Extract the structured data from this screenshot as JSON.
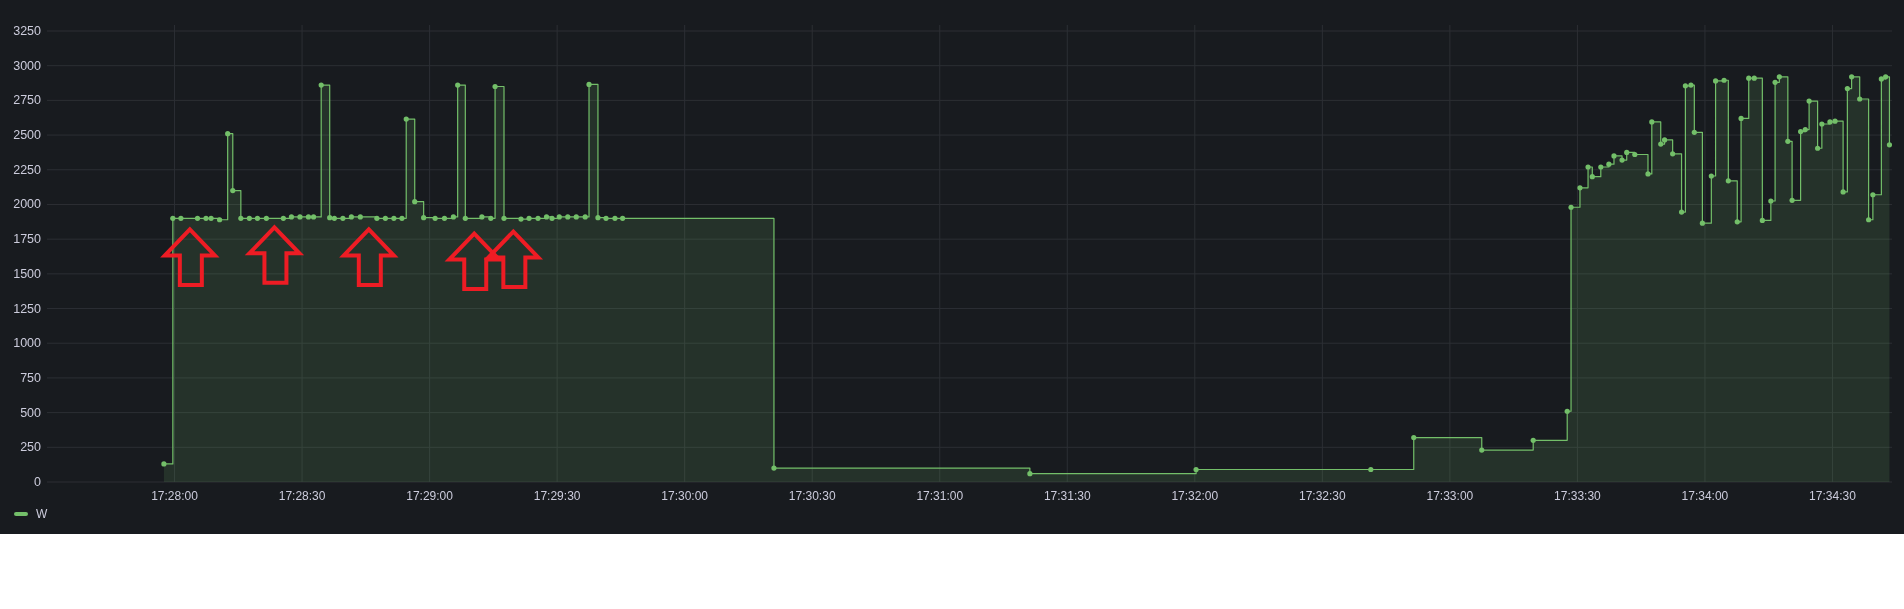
{
  "panel": {
    "chart_data": {
      "type": "area",
      "grid": true,
      "x": [
        62877.5,
        62879.6,
        62879.6,
        62881.5,
        62881.5,
        62885.4,
        62885.4,
        62887.4,
        62887.4,
        62888.6,
        62888.6,
        62890.6,
        62890.6,
        62892.5,
        62892.5,
        62893.7,
        62893.7,
        62895.6,
        62895.6,
        62897.6,
        62897.6,
        62899.5,
        62899.5,
        62901.6,
        62901.6,
        62905.6,
        62905.6,
        62907.5,
        62907.5,
        62909.5,
        62909.5,
        62911.5,
        62911.5,
        62912.7,
        62912.7,
        62914.5,
        62914.5,
        62916.5,
        62916.5,
        62917.6,
        62917.6,
        62919.6,
        62919.6,
        62921.6,
        62921.6,
        62923.7,
        62923.7,
        62927.6,
        62927.6,
        62929.6,
        62929.6,
        62931.6,
        62931.6,
        62933.5,
        62933.5,
        62934.5,
        62934.5,
        62936.5,
        62936.5,
        62938.6,
        62938.6,
        62941.3,
        62941.3,
        62943.5,
        62943.5,
        62945.6,
        62945.6,
        62946.6,
        62946.6,
        62948.4,
        62948.4,
        62952.3,
        62952.3,
        62954.4,
        62954.4,
        62955.4,
        62955.4,
        62957.5,
        62957.5,
        62961.5,
        62961.5,
        62963.4,
        62963.4,
        62965.5,
        62965.5,
        62967.5,
        62967.5,
        62968.8,
        62968.8,
        62970.5,
        62970.5,
        62972.5,
        62972.5,
        62974.5,
        62974.5,
        62976.6,
        62976.6,
        62977.5,
        62977.5,
        62979.6,
        62979.6,
        62981.5,
        62981.5,
        62983.6,
        62983.6,
        62985.4,
        62985.4,
        63021,
        63021,
        63081.2,
        63081.2,
        63120.3,
        63120.3,
        63161.4,
        63161.4,
        63171.5,
        63171.5,
        63187.5,
        63187.5,
        63199.6,
        63199.6,
        63207.6,
        63207.6,
        63208.5,
        63208.5,
        63210.6,
        63210.6,
        63212.5,
        63212.5,
        63213.5,
        63213.5,
        63215.5,
        63215.5,
        63217.4,
        63217.4,
        63218.6,
        63218.6,
        63220.5,
        63220.5,
        63221.6,
        63221.6,
        63223.5,
        63223.5,
        63226.6,
        63226.6,
        63227.5,
        63227.5,
        63229.6,
        63229.6,
        63230.5,
        63230.5,
        63232.4,
        63232.4,
        63234.5,
        63234.5,
        63235.4,
        63235.4,
        63236.7,
        63236.7,
        63237.5,
        63237.5,
        63239.4,
        63239.4,
        63241.5,
        63241.5,
        63242.5,
        63242.5,
        63244.5,
        63244.5,
        63245.5,
        63245.5,
        63247.6,
        63247.6,
        63248.5,
        63248.5,
        63250.3,
        63250.3,
        63251.6,
        63251.6,
        63253.5,
        63253.5,
        63255.5,
        63255.5,
        63256.5,
        63256.5,
        63257.5,
        63257.5,
        63259.5,
        63259.5,
        63260.5,
        63260.5,
        63262.5,
        63262.5,
        63263.6,
        63263.6,
        63264.5,
        63264.5,
        63266.5,
        63266.5,
        63267.5,
        63267.5,
        63269.4,
        63269.4,
        63270.6,
        63270.6,
        63272.5,
        63272.5,
        63273.5,
        63273.5,
        63274.5,
        63274.5,
        63276.4,
        63276.4,
        63278.5,
        63278.5,
        63279.5,
        63279.5,
        63281.5,
        63281.5,
        63282.5,
        63282.5,
        63283.4,
        63283.4
      ],
      "series": [
        {
          "name": "W",
          "color": "#73bf69",
          "values": [
            130,
            130,
            1900,
            1900,
            1900,
            1900,
            1900,
            1900,
            1900,
            1900,
            1900,
            1900,
            1890,
            1890,
            2510,
            2510,
            2100,
            2100,
            1900,
            1900,
            1900,
            1900,
            1900,
            1900,
            1900,
            1900,
            1900,
            1900,
            1910,
            1910,
            1910,
            1910,
            1910,
            1910,
            1910,
            1910,
            2860,
            2860,
            1905,
            1905,
            1900,
            1900,
            1900,
            1900,
            1910,
            1910,
            1910,
            1910,
            1900,
            1900,
            1900,
            1900,
            1900,
            1900,
            1900,
            1900,
            2615,
            2615,
            2020,
            2020,
            1905,
            1905,
            1900,
            1900,
            1900,
            1900,
            1910,
            1910,
            2860,
            2860,
            1900,
            1900,
            1910,
            1910,
            1900,
            1900,
            2850,
            2850,
            1900,
            1900,
            1895,
            1895,
            1900,
            1900,
            1900,
            1900,
            1910,
            1910,
            1900,
            1900,
            1910,
            1910,
            1910,
            1910,
            1910,
            1910,
            1910,
            1910,
            2865,
            2865,
            1905,
            1905,
            1900,
            1900,
            1900,
            1900,
            1900,
            1900,
            100,
            100,
            60,
            60,
            90,
            90,
            90,
            90,
            320,
            320,
            230,
            230,
            300,
            300,
            510,
            510,
            1980,
            1980,
            2120,
            2120,
            2270,
            2270,
            2200,
            2200,
            2270,
            2270,
            2290,
            2290,
            2350,
            2350,
            2320,
            2320,
            2375,
            2375,
            2360,
            2360,
            2220,
            2220,
            2595,
            2595,
            2435,
            2435,
            2465,
            2465,
            2365,
            2365,
            1945,
            1945,
            2855,
            2855,
            2860,
            2860,
            2520,
            2520,
            1865,
            1865,
            2205,
            2205,
            2890,
            2890,
            2895,
            2895,
            2170,
            2170,
            1875,
            1875,
            2620,
            2620,
            2910,
            2910,
            2910,
            2910,
            1885,
            1885,
            2025,
            2025,
            2880,
            2880,
            2920,
            2920,
            2455,
            2455,
            2030,
            2030,
            2525,
            2525,
            2540,
            2540,
            2745,
            2745,
            2405,
            2405,
            2580,
            2580,
            2595,
            2595,
            2600,
            2600,
            2090,
            2090,
            2835,
            2835,
            2920,
            2920,
            2760,
            2760,
            1890,
            1890,
            2070,
            2070,
            2905,
            2905,
            2920,
            2920,
            2430
          ]
        }
      ],
      "xlim": [
        62850,
        63284
      ],
      "ylim": [
        0,
        3250
      ],
      "xticks": [
        {
          "value": 62880,
          "label": "17:28:00"
        },
        {
          "value": 62910,
          "label": "17:28:30"
        },
        {
          "value": 62940,
          "label": "17:29:00"
        },
        {
          "value": 62970,
          "label": "17:29:30"
        },
        {
          "value": 63000,
          "label": "17:30:00"
        },
        {
          "value": 63030,
          "label": "17:30:30"
        },
        {
          "value": 63060,
          "label": "17:31:00"
        },
        {
          "value": 63090,
          "label": "17:31:30"
        },
        {
          "value": 63120,
          "label": "17:32:00"
        },
        {
          "value": 63150,
          "label": "17:32:30"
        },
        {
          "value": 63180,
          "label": "17:33:00"
        },
        {
          "value": 63210,
          "label": "17:33:30"
        },
        {
          "value": 63240,
          "label": "17:34:00"
        },
        {
          "value": 63270,
          "label": "17:34:30"
        }
      ],
      "yticks": [
        0,
        250,
        500,
        750,
        1000,
        1250,
        1500,
        1750,
        2000,
        2250,
        2500,
        2750,
        3000,
        3250
      ]
    }
  }
}
